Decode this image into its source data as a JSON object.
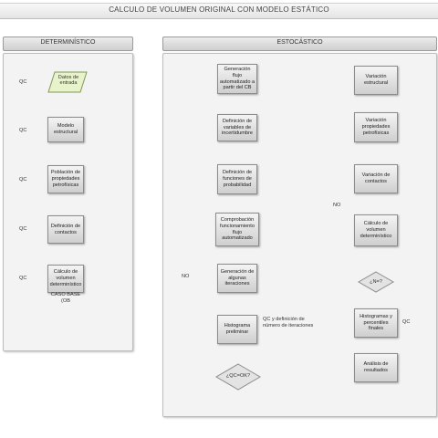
{
  "title": "CALCULO DE VOLUMEN ORIGINAL CON MODELO ESTÁTICO",
  "left_panel": {
    "heading": "DETERMINÍSTICO",
    "steps": [
      "Datos de entrada",
      "Modelo estructural",
      "Población de propiedades petrofísicas",
      "Definición de contactos",
      "Cálculo de volumen determinístico"
    ],
    "qc_labels": [
      "QC",
      "QC",
      "QC",
      "QC",
      "QC"
    ],
    "note": "CASO BASE (OB"
  },
  "right_panel": {
    "heading": "ESTOCÁSTICO",
    "col1_steps": [
      "Generación flujo automatizado a partir del CB",
      "Definición de variables de incertidumbre",
      "Definición de funciones de probabilidad",
      "Comprobación funcionamiento flujo automatizado",
      "Generación de algunas iteraciones",
      "Histograma preliminar"
    ],
    "col1_note": "QC y definición de número de iteraciones",
    "col1_decision": "¿QC=OK?",
    "col1_no": "NO",
    "col2_steps": [
      "Variación estructural",
      "Variación propiedades petrofísicas",
      "Variación de contactos",
      "Cálculo de volumen determinístico"
    ],
    "col2_decision": "¿N=?",
    "col2_no": "NO",
    "col2_bottom_steps": [
      "Histogramas y percentiles finales",
      "Análisis de resultados"
    ],
    "col2_qc": "QC"
  },
  "colors": {
    "input_fill": "#e8f3cc",
    "input_border": "#7f9a55",
    "box_border": "#8c8c8c",
    "line": "#8a8a8a"
  }
}
